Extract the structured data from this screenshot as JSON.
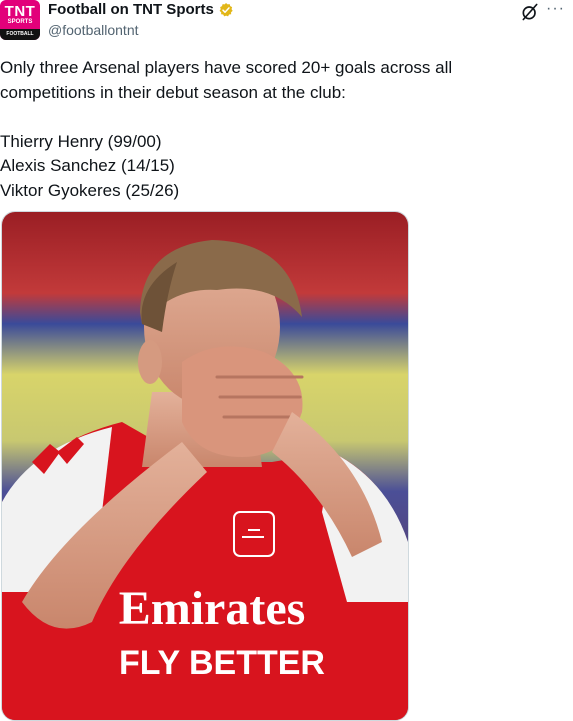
{
  "author": {
    "avatar_text_main": "TNT",
    "avatar_text_sub": "SPORTS",
    "avatar_text_bottom": "FOOTBALL",
    "display_name": "Football on TNT Sports",
    "handle": "@footballontnt",
    "verified_color": "#e2b719"
  },
  "tweet": {
    "line1": "Only three Arsenal players have scored 20+ goals across all",
    "line2": "competitions in their debut season at the club:",
    "players": [
      "Thierry Henry (99/00)",
      "Alexis Sanchez (14/15)",
      "Viktor Gyokeres (25/26)"
    ]
  },
  "media": {
    "sponsor_line1": "Emirates",
    "sponsor_line2": "FLY BETTER",
    "kit_color": "#d8141e"
  },
  "icons": {
    "grok": "grok-icon",
    "more": "more-options-icon",
    "verified": "verified-badge-icon"
  },
  "more_glyph": "···"
}
